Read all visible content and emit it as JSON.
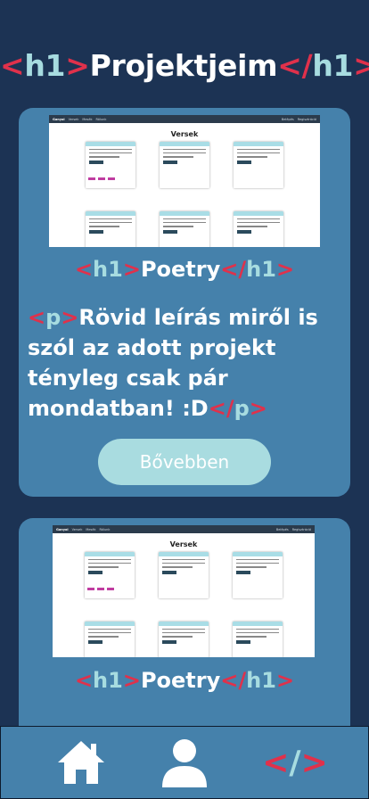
{
  "header": {
    "open_tag": "<",
    "tag_name": "h1",
    "close_bracket": ">",
    "title": "Projektjeim",
    "end_open": "</",
    "end_tag_name": "h1",
    "end_close": ">"
  },
  "projects": [
    {
      "preview": {
        "nav_brand": "Ganyol",
        "nav_links": [
          "Versek",
          "Mesék",
          "Rólunk"
        ],
        "nav_right": [
          "Belépés",
          "Regisztráció"
        ],
        "page_title": "Versek"
      },
      "title": {
        "open": "<",
        "tag": "h1",
        "close": ">",
        "text": "Poetry",
        "end_open": "</",
        "end_tag": "h1",
        "end_close": ">"
      },
      "description": {
        "open": "<",
        "tag": "p",
        "close": ">",
        "text": "Rövid leírás miről is szól az adott projekt tényleg csak pár mondatban! :D",
        "end_open": "</",
        "end_tag": "p",
        "end_close": ">"
      },
      "button_label": "Bővebben"
    },
    {
      "preview": {
        "nav_brand": "Ganyol",
        "nav_links": [
          "Versek",
          "Mesék",
          "Rólunk"
        ],
        "nav_right": [
          "Belépés",
          "Regisztráció"
        ],
        "page_title": "Versek"
      },
      "title": {
        "open": "<",
        "tag": "h1",
        "close": ">",
        "text": "Poetry",
        "end_open": "</",
        "end_tag": "h1",
        "end_close": ">"
      }
    }
  ],
  "bottom_nav": {
    "icons": [
      "home-icon",
      "user-icon",
      "code-icon"
    ],
    "code_open": "<",
    "code_slash": "/",
    "code_close": ">"
  },
  "colors": {
    "background": "#1c3354",
    "card": "#4581ab",
    "accent_red": "#e0314b",
    "accent_light": "#a7dce0"
  }
}
